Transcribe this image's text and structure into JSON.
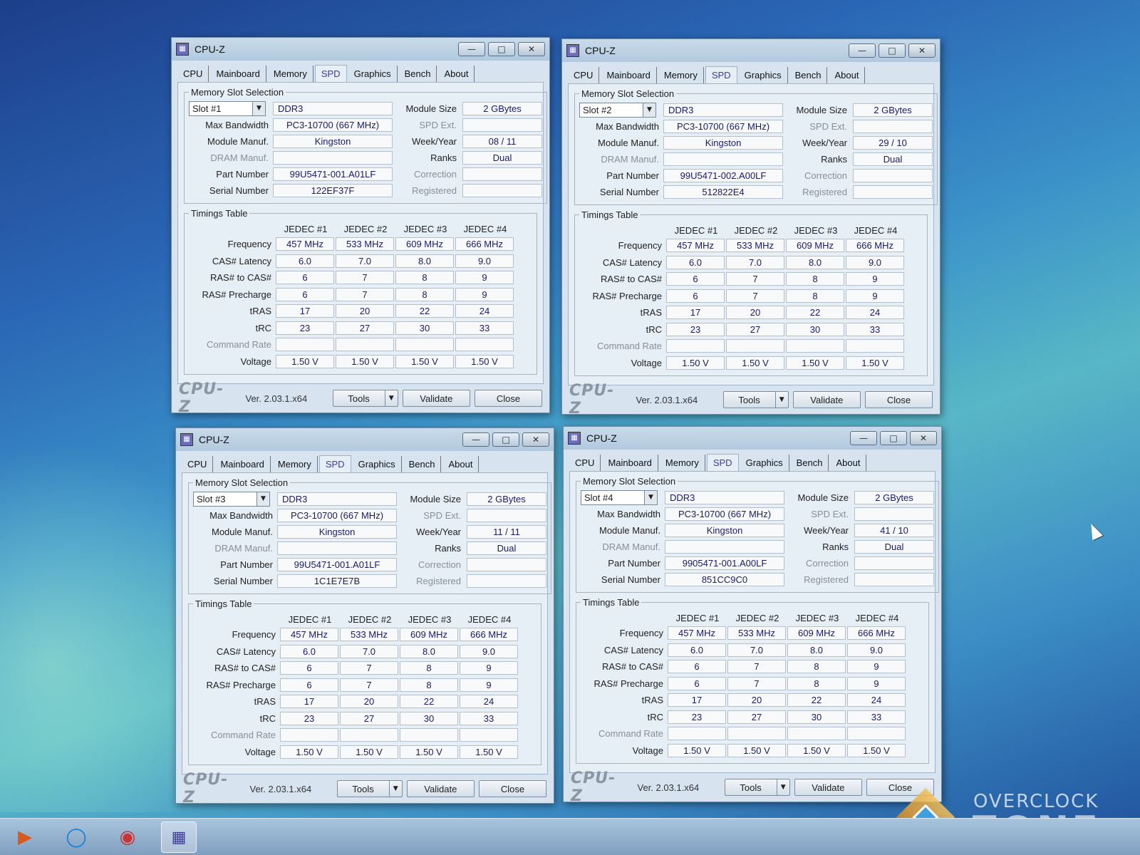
{
  "common": {
    "title": "CPU-Z",
    "app_icon": "cpuz-icon",
    "tabs": [
      "CPU",
      "Mainboard",
      "Memory",
      "SPD",
      "Graphics",
      "Bench",
      "About"
    ],
    "active_tab": "SPD",
    "memory_slot_selection_legend": "Memory Slot Selection",
    "timings_table_legend": "Timings Table",
    "labels": {
      "max_bandwidth": "Max Bandwidth",
      "module_manuf": "Module Manuf.",
      "dram_manuf": "DRAM Manuf.",
      "part_number": "Part Number",
      "serial_number": "Serial Number",
      "module_size": "Module Size",
      "spd_ext": "SPD Ext.",
      "week_year": "Week/Year",
      "ranks": "Ranks",
      "correction": "Correction",
      "registered": "Registered"
    },
    "timing_headers": [
      "JEDEC #1",
      "JEDEC #2",
      "JEDEC #3",
      "JEDEC #4"
    ],
    "timing_rows": [
      {
        "label": "Frequency",
        "values": [
          "457 MHz",
          "533 MHz",
          "609 MHz",
          "666 MHz"
        ]
      },
      {
        "label": "CAS# Latency",
        "values": [
          "6.0",
          "7.0",
          "8.0",
          "9.0"
        ]
      },
      {
        "label": "RAS# to CAS#",
        "values": [
          "6",
          "7",
          "8",
          "9"
        ]
      },
      {
        "label": "RAS# Precharge",
        "values": [
          "6",
          "7",
          "8",
          "9"
        ]
      },
      {
        "label": "tRAS",
        "values": [
          "17",
          "20",
          "22",
          "24"
        ]
      },
      {
        "label": "tRC",
        "values": [
          "23",
          "27",
          "30",
          "33"
        ]
      },
      {
        "label": "Command Rate",
        "values": [
          "",
          "",
          "",
          ""
        ]
      },
      {
        "label": "Voltage",
        "values": [
          "1.50 V",
          "1.50 V",
          "1.50 V",
          "1.50 V"
        ]
      }
    ],
    "footer": {
      "brand": "CPU-Z",
      "version": "Ver. 2.03.1.x64",
      "tools": "Tools",
      "validate": "Validate",
      "close": "Close"
    }
  },
  "windows": [
    {
      "slot": "Slot #1",
      "type": "DDR3",
      "module_size": "2 GBytes",
      "max_bandwidth": "PC3-10700 (667 MHz)",
      "spd_ext": "",
      "module_manuf": "Kingston",
      "week_year": "08 / 11",
      "dram_manuf": "",
      "ranks": "Dual",
      "part_number": "99U5471-001.A01LF",
      "correction": "",
      "serial_number": "122EF37F",
      "registered": ""
    },
    {
      "slot": "Slot #2",
      "type": "DDR3",
      "module_size": "2 GBytes",
      "max_bandwidth": "PC3-10700 (667 MHz)",
      "spd_ext": "",
      "module_manuf": "Kingston",
      "week_year": "29 / 10",
      "dram_manuf": "",
      "ranks": "Dual",
      "part_number": "99U5471-002.A00LF",
      "correction": "",
      "serial_number": "512822E4",
      "registered": ""
    },
    {
      "slot": "Slot #3",
      "type": "DDR3",
      "module_size": "2 GBytes",
      "max_bandwidth": "PC3-10700 (667 MHz)",
      "spd_ext": "",
      "module_manuf": "Kingston",
      "week_year": "11 / 11",
      "dram_manuf": "",
      "ranks": "Dual",
      "part_number": "99U5471-001.A01LF",
      "correction": "",
      "serial_number": "1C1E7E7B",
      "registered": ""
    },
    {
      "slot": "Slot #4",
      "type": "DDR3",
      "module_size": "2 GBytes",
      "max_bandwidth": "PC3-10700 (667 MHz)",
      "spd_ext": "",
      "module_manuf": "Kingston",
      "week_year": "41 / 10",
      "dram_manuf": "",
      "ranks": "Dual",
      "part_number": "9905471-001.A00LF",
      "correction": "",
      "serial_number": "851CC9C0",
      "registered": ""
    }
  ],
  "taskbar": {
    "icons": [
      "media-player-icon",
      "edge-icon",
      "chrome-icon",
      "cpuz-taskbar-icon"
    ]
  },
  "watermark": {
    "top": "OVERCLOCK",
    "bottom": "ZONE"
  }
}
